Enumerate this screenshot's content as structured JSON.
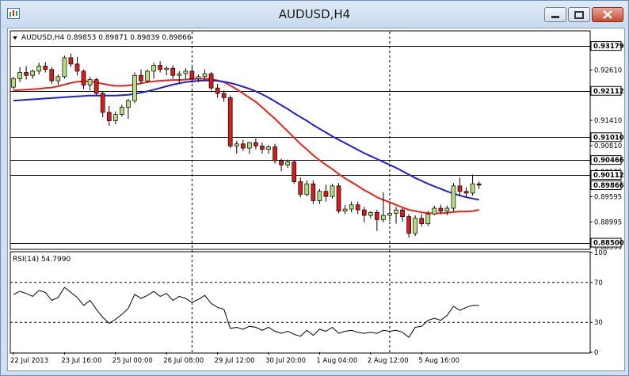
{
  "window": {
    "title": "AUDUSD,H4",
    "buttons": [
      "minimize",
      "restore",
      "close"
    ]
  },
  "chart_data": [
    {
      "type": "candlestick",
      "symbol": "AUDUSD,H4",
      "header": "AUDUSD,H4  0.89853 0.89871 0.89839 0.89866",
      "ylim": [
        0.8836,
        0.9352
      ],
      "y_ticks": [
        "0.92610",
        "0.91410",
        "0.90810",
        "0.90185",
        "0.89595",
        "0.88995",
        "0.88395"
      ],
      "horizontal_lines": [
        {
          "value": 0.93179,
          "label": "0.93179"
        },
        {
          "value": 0.92112,
          "label": "0.92112"
        },
        {
          "value": 0.9101,
          "label": "0.91010"
        },
        {
          "value": 0.90466,
          "label": "0.90466"
        },
        {
          "value": 0.90112,
          "label": "0.90112"
        },
        {
          "value": 0.885,
          "label": "0.88500"
        }
      ],
      "current_price": {
        "value": 0.89866,
        "label": "0.89866"
      },
      "x_labels": [
        "22 Jul 2013",
        "23 Jul 16:00",
        "25 Jul 00:00",
        "26 Jul 08:00",
        "29 Jul 12:00",
        "30 Jul 20:00",
        "1 Aug 04:00",
        "2 Aug 12:00",
        "5 Aug 16:00"
      ],
      "vertical_dashed_at_bars": [
        28,
        59
      ],
      "candles": [
        [
          0.922,
          0.9245,
          0.9215,
          0.924
        ],
        [
          0.924,
          0.9268,
          0.9232,
          0.9255
        ],
        [
          0.9255,
          0.927,
          0.9238,
          0.9248
        ],
        [
          0.9248,
          0.9262,
          0.924,
          0.9258
        ],
        [
          0.9258,
          0.9278,
          0.925,
          0.927
        ],
        [
          0.927,
          0.928,
          0.9255,
          0.9262
        ],
        [
          0.9262,
          0.9268,
          0.9228,
          0.9235
        ],
        [
          0.9235,
          0.925,
          0.9225,
          0.9245
        ],
        [
          0.9245,
          0.9295,
          0.924,
          0.929
        ],
        [
          0.929,
          0.93,
          0.9268,
          0.9275
        ],
        [
          0.9275,
          0.9292,
          0.9248,
          0.9258
        ],
        [
          0.9258,
          0.9262,
          0.9215,
          0.9225
        ],
        [
          0.9225,
          0.9245,
          0.9212,
          0.9238
        ],
        [
          0.9238,
          0.9242,
          0.92,
          0.9205
        ],
        [
          0.9205,
          0.921,
          0.9148,
          0.916
        ],
        [
          0.916,
          0.9175,
          0.9128,
          0.914
        ],
        [
          0.914,
          0.9162,
          0.9132,
          0.9155
        ],
        [
          0.9155,
          0.9178,
          0.915,
          0.9172
        ],
        [
          0.9172,
          0.9192,
          0.9145,
          0.9188
        ],
        [
          0.9188,
          0.9255,
          0.9182,
          0.9248
        ],
        [
          0.9248,
          0.9262,
          0.9228,
          0.9235
        ],
        [
          0.9235,
          0.9262,
          0.923,
          0.9258
        ],
        [
          0.9258,
          0.9278,
          0.924,
          0.9272
        ],
        [
          0.9272,
          0.9282,
          0.9255,
          0.9262
        ],
        [
          0.9262,
          0.927,
          0.9248,
          0.9265
        ],
        [
          0.9265,
          0.9272,
          0.924,
          0.9248
        ],
        [
          0.9248,
          0.9258,
          0.923,
          0.9252
        ],
        [
          0.9252,
          0.9265,
          0.924,
          0.9258
        ],
        [
          0.9258,
          0.9268,
          0.923,
          0.924
        ],
        [
          0.924,
          0.925,
          0.9232,
          0.9245
        ],
        [
          0.9245,
          0.9262,
          0.9235,
          0.9252
        ],
        [
          0.9252,
          0.9256,
          0.9212,
          0.9218
        ],
        [
          0.9218,
          0.9228,
          0.9195,
          0.9205
        ],
        [
          0.9205,
          0.9212,
          0.9185,
          0.9195
        ],
        [
          0.9195,
          0.92,
          0.9075,
          0.908
        ],
        [
          0.908,
          0.9092,
          0.9062,
          0.9085
        ],
        [
          0.9085,
          0.9095,
          0.9068,
          0.9075
        ],
        [
          0.9075,
          0.909,
          0.9062,
          0.9088
        ],
        [
          0.9088,
          0.9098,
          0.9072,
          0.908
        ],
        [
          0.908,
          0.9088,
          0.9062,
          0.9072
        ],
        [
          0.9072,
          0.9082,
          0.9062,
          0.9078
        ],
        [
          0.9078,
          0.9085,
          0.9038,
          0.9045
        ],
        [
          0.9045,
          0.905,
          0.902,
          0.9035
        ],
        [
          0.9035,
          0.9048,
          0.9028,
          0.9042
        ],
        [
          0.9042,
          0.9046,
          0.899,
          0.8995
        ],
        [
          0.8995,
          0.9005,
          0.8958,
          0.8965
        ],
        [
          0.8965,
          0.8998,
          0.896,
          0.899
        ],
        [
          0.899,
          0.8998,
          0.8942,
          0.895
        ],
        [
          0.895,
          0.8978,
          0.8942,
          0.8972
        ],
        [
          0.8972,
          0.8988,
          0.8948,
          0.896
        ],
        [
          0.896,
          0.899,
          0.8955,
          0.8985
        ],
        [
          0.8985,
          0.8992,
          0.892,
          0.8925
        ],
        [
          0.8925,
          0.894,
          0.8918,
          0.893
        ],
        [
          0.893,
          0.8948,
          0.8922,
          0.894
        ],
        [
          0.894,
          0.8948,
          0.8918,
          0.8928
        ],
        [
          0.8928,
          0.8935,
          0.8898,
          0.8915
        ],
        [
          0.8915,
          0.8925,
          0.8908,
          0.8922
        ],
        [
          0.8922,
          0.8928,
          0.8878,
          0.8905
        ],
        [
          0.8905,
          0.897,
          0.8898,
          0.8915
        ],
        [
          0.8915,
          0.8945,
          0.8902,
          0.892
        ],
        [
          0.892,
          0.8935,
          0.8895,
          0.8928
        ],
        [
          0.8928,
          0.8932,
          0.89,
          0.8912
        ],
        [
          0.8912,
          0.8918,
          0.8862,
          0.8872
        ],
        [
          0.8872,
          0.8915,
          0.8866,
          0.8908
        ],
        [
          0.8908,
          0.8918,
          0.8888,
          0.8895
        ],
        [
          0.8895,
          0.8925,
          0.889,
          0.8918
        ],
        [
          0.8918,
          0.8938,
          0.8915,
          0.8932
        ],
        [
          0.8932,
          0.894,
          0.8918,
          0.8925
        ],
        [
          0.8925,
          0.8938,
          0.8915,
          0.8932
        ],
        [
          0.8932,
          0.8992,
          0.8925,
          0.8985
        ],
        [
          0.8985,
          0.9005,
          0.8962,
          0.8972
        ],
        [
          0.8972,
          0.8982,
          0.8958,
          0.8968
        ],
        [
          0.8968,
          0.9012,
          0.8962,
          0.899
        ],
        [
          0.899,
          0.8995,
          0.8978,
          0.8987
        ]
      ],
      "indicators": [
        {
          "name": "MA red",
          "color": "#e8231d",
          "values": [
            0.9212,
            0.9213,
            0.9214,
            0.9215,
            0.9216,
            0.9218,
            0.9219,
            0.9222,
            0.9226,
            0.923,
            0.9233,
            0.9234,
            0.9234,
            0.9231,
            0.9228,
            0.9225,
            0.9223,
            0.9223,
            0.9224,
            0.9226,
            0.9229,
            0.9232,
            0.9234,
            0.9235,
            0.9236,
            0.9237,
            0.9237,
            0.9238,
            0.9239,
            0.924,
            0.924,
            0.9239,
            0.9236,
            0.9232,
            0.9224,
            0.9215,
            0.9205,
            0.9195,
            0.9185,
            0.9172,
            0.9158,
            0.9145,
            0.913,
            0.9115,
            0.91,
            0.9085,
            0.9072,
            0.9058,
            0.9046,
            0.9035,
            0.9025,
            0.9013,
            0.9003,
            0.8994,
            0.8985,
            0.8975,
            0.8967,
            0.8958,
            0.8952,
            0.8946,
            0.894,
            0.8934,
            0.8928,
            0.8925,
            0.8922,
            0.892,
            0.892,
            0.892,
            0.8921,
            0.8923,
            0.8924,
            0.8924,
            0.8925,
            0.8928
          ]
        },
        {
          "name": "MA blue",
          "color": "#1f1fcc",
          "values": [
            0.9188,
            0.9189,
            0.919,
            0.9191,
            0.9192,
            0.9193,
            0.9194,
            0.9195,
            0.9196,
            0.9197,
            0.9198,
            0.9199,
            0.92,
            0.92,
            0.92,
            0.92,
            0.92,
            0.9201,
            0.9202,
            0.9204,
            0.9207,
            0.921,
            0.9214,
            0.9218,
            0.9222,
            0.9226,
            0.9229,
            0.9232,
            0.9234,
            0.9235,
            0.9236,
            0.9236,
            0.9235,
            0.9233,
            0.923,
            0.9226,
            0.9221,
            0.9216,
            0.921,
            0.9203,
            0.9195,
            0.9186,
            0.9177,
            0.9168,
            0.9158,
            0.9149,
            0.914,
            0.913,
            0.9121,
            0.9112,
            0.9103,
            0.9095,
            0.9087,
            0.9079,
            0.9071,
            0.9063,
            0.9056,
            0.9049,
            0.9042,
            0.9035,
            0.9028,
            0.902,
            0.9012,
            0.9004,
            0.8997,
            0.899,
            0.8984,
            0.8978,
            0.8972,
            0.8967,
            0.8962,
            0.8958,
            0.8955,
            0.8952
          ]
        }
      ]
    },
    {
      "type": "line",
      "header": "RSI(14) 54.7990",
      "ylim": [
        0,
        100
      ],
      "y_ticks": [
        "100",
        "70",
        "30",
        "0"
      ],
      "levels": [
        70,
        30
      ],
      "series": [
        {
          "values": [
            58,
            61,
            59,
            56,
            62,
            60,
            52,
            55,
            65,
            60,
            55,
            47,
            52,
            43,
            35,
            29,
            33,
            38,
            44,
            58,
            54,
            57,
            61,
            56,
            59,
            52,
            56,
            54,
            50,
            53,
            57,
            49,
            45,
            43,
            24,
            25,
            23,
            26,
            25,
            22,
            25,
            21,
            19,
            21,
            18,
            16,
            22,
            17,
            23,
            21,
            25,
            19,
            21,
            22,
            20,
            19,
            20,
            19,
            22,
            21,
            22,
            20,
            15,
            25,
            26,
            32,
            34,
            32,
            37,
            46,
            42,
            45,
            47,
            47
          ]
        }
      ]
    }
  ]
}
